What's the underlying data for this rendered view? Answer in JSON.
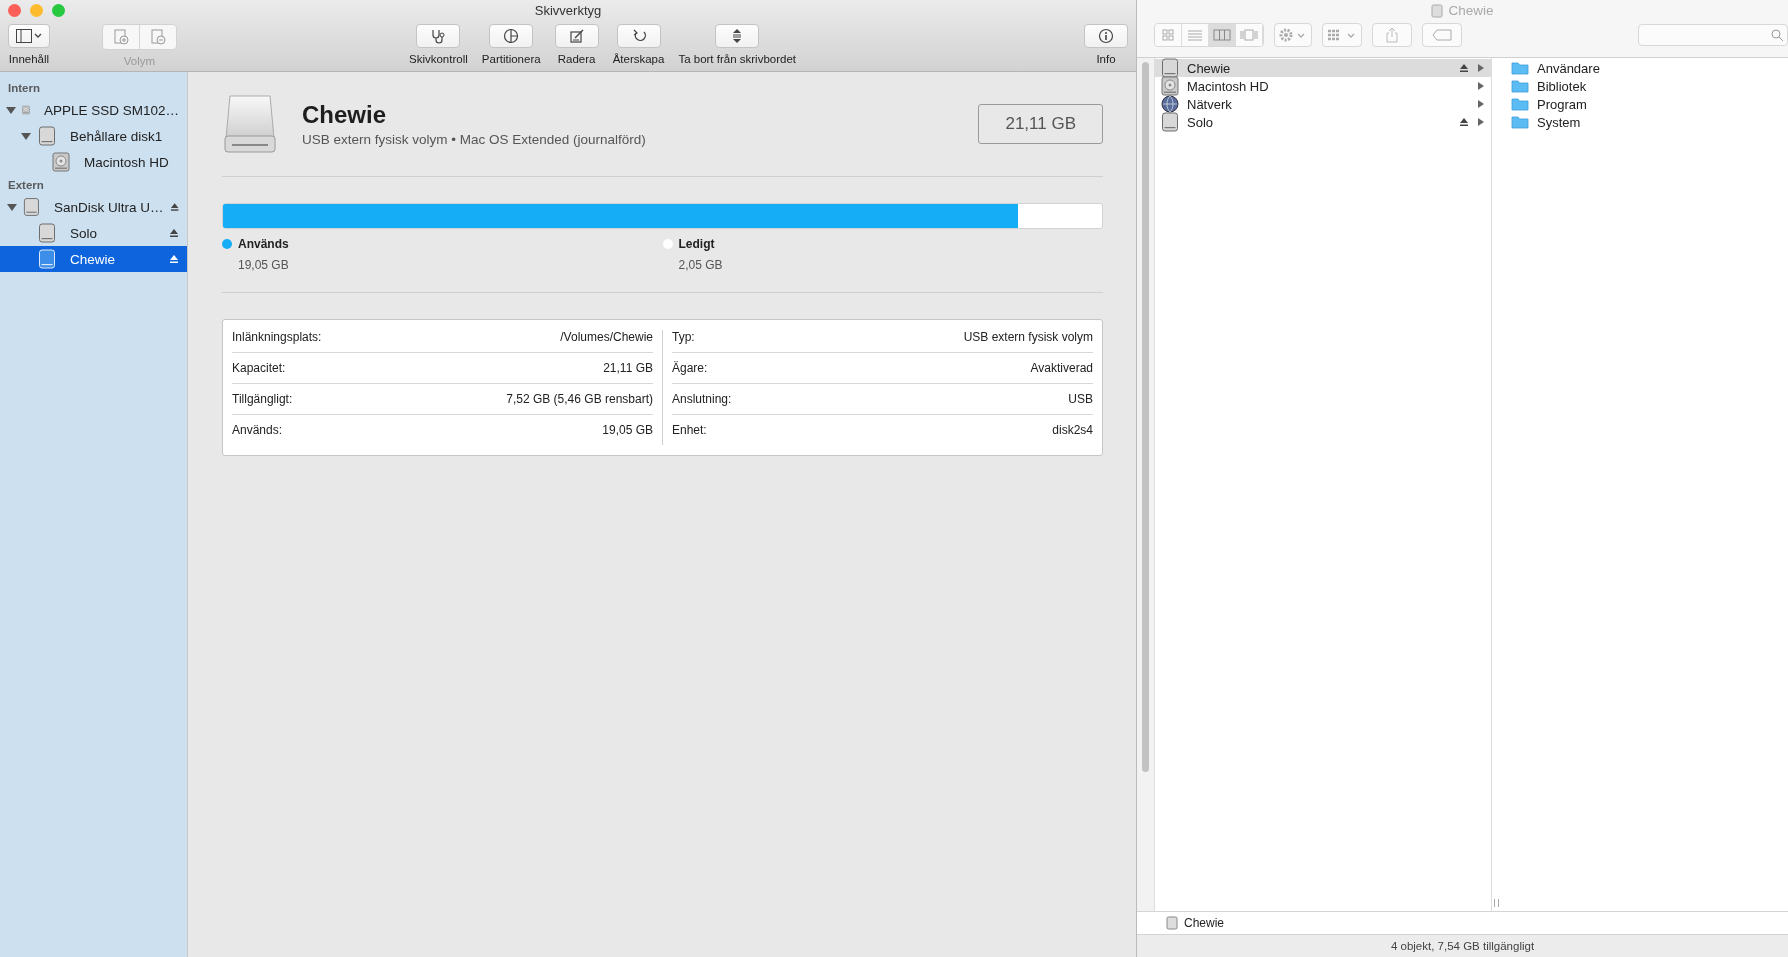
{
  "window": {
    "title": "Skivverktyg"
  },
  "toolbar": {
    "view": {
      "label": "Innehåll"
    },
    "volume": {
      "label": "Volym",
      "disabled": true
    },
    "actions": [
      {
        "label": "Skivkontroll",
        "disabled": false
      },
      {
        "label": "Partitionera",
        "disabled": false
      },
      {
        "label": "Radera",
        "disabled": false
      },
      {
        "label": "Återskapa",
        "disabled": false
      },
      {
        "label": "Ta bort från skrivbordet",
        "disabled": false
      }
    ],
    "info": {
      "label": "Info"
    }
  },
  "sidebar": {
    "sections": [
      {
        "heading": "Intern",
        "items": [
          {
            "label": "APPLE SSD SM102…",
            "kind": "internal",
            "expanded": true,
            "selected": false,
            "ejectable": false,
            "children": [
              {
                "label": "Behållare disk1",
                "kind": "external",
                "expanded": true,
                "selected": false,
                "ejectable": false,
                "children": [
                  {
                    "label": "Macintosh HD",
                    "kind": "internal",
                    "selected": false,
                    "ejectable": false
                  }
                ]
              }
            ]
          }
        ]
      },
      {
        "heading": "Extern",
        "items": [
          {
            "label": "SanDisk Ultra U…",
            "kind": "external",
            "expanded": true,
            "selected": false,
            "ejectable": true,
            "children": [
              {
                "label": "Solo",
                "kind": "external",
                "selected": false,
                "ejectable": true
              },
              {
                "label": "Chewie",
                "kind": "external",
                "selected": true,
                "ejectable": true
              }
            ]
          }
        ]
      }
    ]
  },
  "volume": {
    "name": "Chewie",
    "description": "USB extern fysisk volym • Mac OS Extended (journalförd)",
    "size": "21,11 GB"
  },
  "usage": {
    "level": 0.905,
    "legend": [
      {
        "label": "Används",
        "value": "19,05 GB",
        "color": "#15adf5"
      },
      {
        "label": "Ledigt",
        "value": "2,05 GB",
        "color": "#ffffff"
      }
    ]
  },
  "info_table": {
    "left": [
      {
        "label": "Inlänkningsplats:",
        "value": "/Volumes/Chewie"
      },
      {
        "label": "Kapacitet:",
        "value": "21,11 GB"
      },
      {
        "label": "Tillgängligt:",
        "value": "7,52 GB (5,46 GB rensbart)"
      },
      {
        "label": "Används:",
        "value": "19,05 GB"
      }
    ],
    "right": [
      {
        "label": "Typ:",
        "value": "USB extern fysisk volym"
      },
      {
        "label": "Ägare:",
        "value": "Avaktiverad"
      },
      {
        "label": "Anslutning:",
        "value": "USB"
      },
      {
        "label": "Enhet:",
        "value": "disk2s4"
      }
    ]
  },
  "finder": {
    "title": "Chewie",
    "view_modes": [
      {
        "selected": false
      },
      {
        "selected": false
      },
      {
        "selected": true
      },
      {
        "selected": false
      }
    ],
    "column_1": [
      {
        "label": "Chewie",
        "kind": "volume",
        "selected": true,
        "ejectable": true
      },
      {
        "label": "Macintosh HD",
        "kind": "internal",
        "selected": false,
        "ejectable": false
      },
      {
        "label": "Nätverk",
        "kind": "network",
        "selected": false,
        "ejectable": false
      },
      {
        "label": "Solo",
        "kind": "volume",
        "selected": false,
        "ejectable": true
      }
    ],
    "column_2": [
      {
        "label": "Användare"
      },
      {
        "label": "Bibliotek"
      },
      {
        "label": "Program"
      },
      {
        "label": "System"
      }
    ],
    "path_bar": {
      "label": "Chewie"
    },
    "status_bar": "4 objekt, 7,54 GB tillgängligt"
  }
}
